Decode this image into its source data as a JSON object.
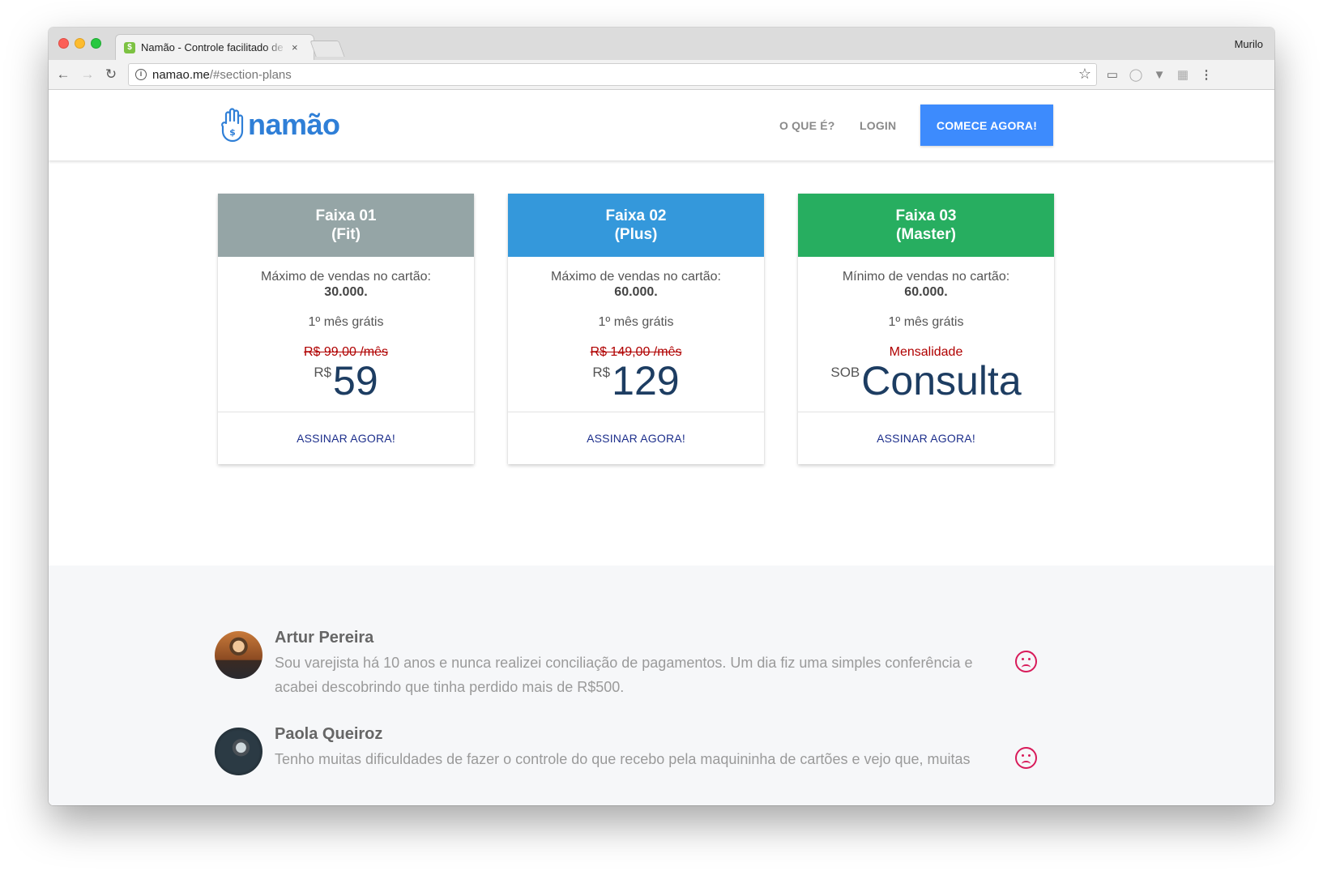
{
  "browser": {
    "tab_title": "Namão - Controle facilitado de",
    "tab_close": "×",
    "profile_name": "Murilo",
    "url_host": "namao.me",
    "url_path": "/#section-plans"
  },
  "header": {
    "logo_text": "namão",
    "nav": {
      "what_is": "O QUE É?",
      "login": "LOGIN"
    },
    "cta_label": "COMECE AGORA!",
    "brand_color": "#2f7fd7",
    "cta_color": "#3d8bfd"
  },
  "plans": [
    {
      "title_line1": "Faixa 01",
      "title_line2": "(Fit)",
      "header_color": "#95a5a6",
      "limit_label": "Máximo de vendas no cartão:",
      "limit_value": "30.000.",
      "free_month": "1º mês grátis",
      "old_price": "R$ 99,00 /mês",
      "currency": "R$",
      "price": "59",
      "button": "ASSINAR AGORA!"
    },
    {
      "title_line1": "Faixa 02",
      "title_line2": "(Plus)",
      "header_color": "#3498db",
      "limit_label": "Máximo de vendas no cartão:",
      "limit_value": "60.000.",
      "free_month": "1º mês grátis",
      "old_price": "R$ 149,00 /mês",
      "currency": "R$",
      "price": "129",
      "button": "ASSINAR AGORA!"
    },
    {
      "title_line1": "Faixa 03",
      "title_line2": "(Master)",
      "header_color": "#27ae60",
      "limit_label": "Mínimo de vendas no cartão:",
      "limit_value": "60.000.",
      "free_month": "1º mês grátis",
      "monthly_label": "Mensalidade",
      "currency": "SOB",
      "price": "Consulta",
      "button": "ASSINAR AGORA!"
    }
  ],
  "testimonials": [
    {
      "name": "Artur Pereira",
      "text": "Sou varejista há 10 anos e nunca realizei conciliação de pagamentos. Um dia fiz uma simples conferência e acabei descobrindo que tinha perdido mais de R$500.",
      "icon": "sad-face-icon"
    },
    {
      "name": "Paola Queiroz",
      "text": "Tenho muitas dificuldades de fazer o controle do que recebo pela maquininha de cartões e vejo que, muitas",
      "icon": "sad-face-icon"
    }
  ]
}
